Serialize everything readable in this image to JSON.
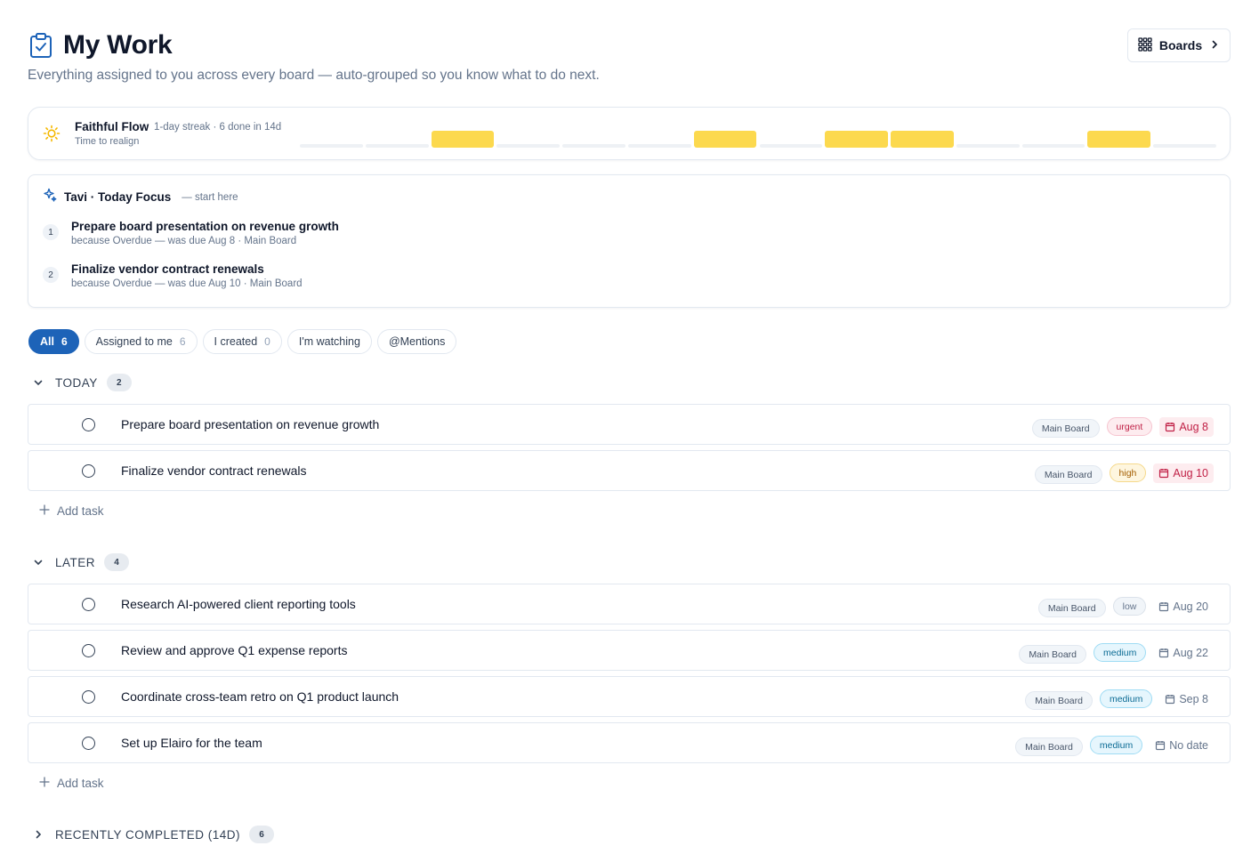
{
  "header": {
    "title": "My Work",
    "subtitle": "Everything assigned to you across every board — auto-grouped so you know what to do next.",
    "boards_button": "Boards"
  },
  "flow": {
    "name": "Faithful Flow",
    "meta": "1-day streak · 6 done in 14d",
    "sub": "Time to realign",
    "activity_days": [
      0,
      0,
      1,
      0,
      0,
      0,
      1,
      0,
      1,
      1,
      0,
      0,
      1,
      0
    ],
    "colors": {
      "active": "#fcd94e",
      "idle": "#eef1f5"
    }
  },
  "focus": {
    "title": "Tavi · Today Focus",
    "hint": "— start here",
    "items": [
      {
        "num": "1",
        "title": "Prepare board presentation on revenue growth",
        "reason": "because Overdue — was due Aug 8 · Main Board"
      },
      {
        "num": "2",
        "title": "Finalize vendor contract renewals",
        "reason": "because Overdue — was due Aug 10 · Main Board"
      }
    ]
  },
  "filters": [
    {
      "label": "All",
      "count": "6",
      "active": true
    },
    {
      "label": "Assigned to me",
      "count": "6"
    },
    {
      "label": "I created",
      "count": "0"
    },
    {
      "label": "I'm watching",
      "count": ""
    },
    {
      "label": "@Mentions",
      "count": ""
    }
  ],
  "groups": {
    "today": {
      "label": "TODAY",
      "count": "2"
    },
    "later": {
      "label": "LATER",
      "count": "4"
    },
    "completed": {
      "label": "RECENTLY COMPLETED (14D)",
      "count": "6"
    }
  },
  "tasks_today": [
    {
      "title": "Prepare board presentation on revenue growth",
      "board": "Main Board",
      "priority": "urgent",
      "due": "Aug 8",
      "overdue": true
    },
    {
      "title": "Finalize vendor contract renewals",
      "board": "Main Board",
      "priority": "high",
      "due": "Aug 10",
      "overdue": true
    }
  ],
  "tasks_later": [
    {
      "title": "Research AI-powered client reporting tools",
      "board": "Main Board",
      "priority": "low",
      "due": "Aug 20",
      "overdue": false
    },
    {
      "title": "Review and approve Q1 expense reports",
      "board": "Main Board",
      "priority": "medium",
      "due": "Aug 22",
      "overdue": false
    },
    {
      "title": "Coordinate cross-team retro on Q1 product launch",
      "board": "Main Board",
      "priority": "medium",
      "due": "Sep 8",
      "overdue": false
    },
    {
      "title": "Set up Elairo for the team",
      "board": "Main Board",
      "priority": "medium",
      "due": "No date",
      "overdue": false
    }
  ],
  "add_task_label": "Add task",
  "accent": "#1d63b8"
}
